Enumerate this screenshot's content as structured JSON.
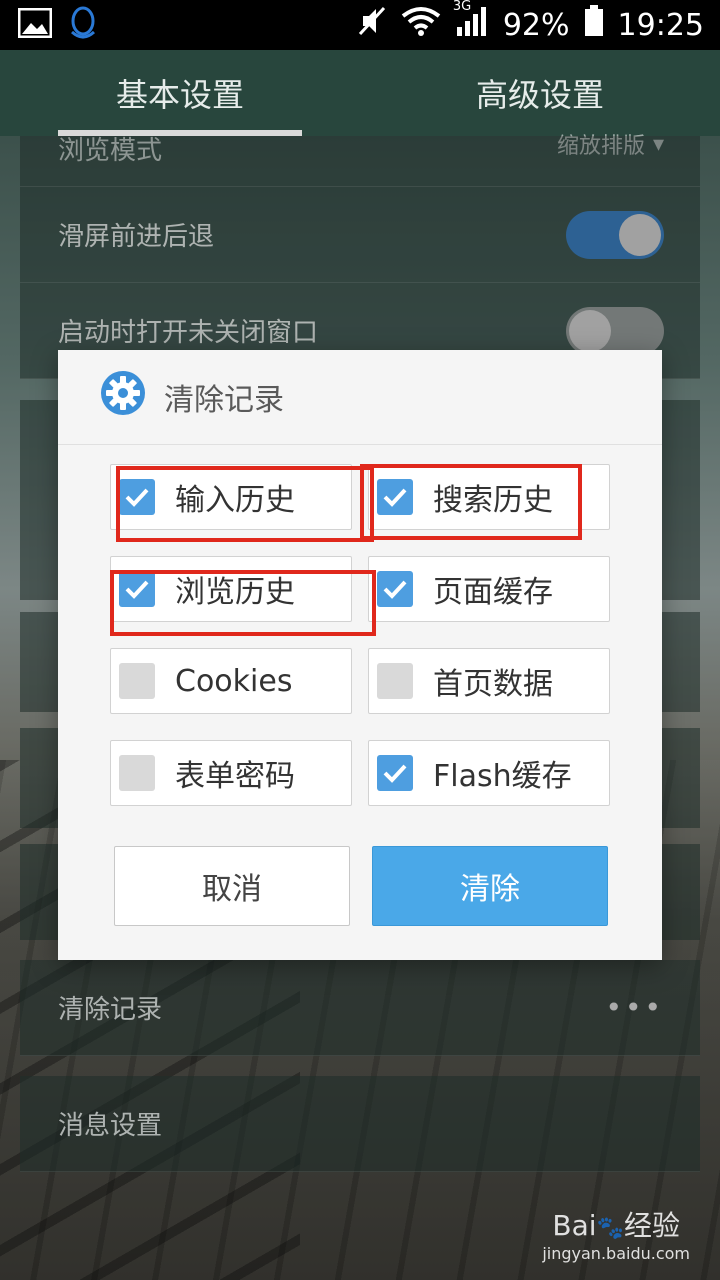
{
  "status_bar": {
    "network": "3G",
    "battery": "92%",
    "time": "19:25",
    "icons": [
      "image-icon",
      "qq-penguin-icon",
      "mute-icon",
      "wifi-icon",
      "signal-icon",
      "battery-icon"
    ]
  },
  "tabs": [
    {
      "label": "基本设置",
      "active": true
    },
    {
      "label": "高级设置",
      "active": false
    }
  ],
  "settings": {
    "browse_mode": {
      "label": "浏览模式",
      "value": "缩放排版"
    },
    "swipe_nav": {
      "label": "滑屏前进后退",
      "enabled": true
    },
    "restore_windows": {
      "label": "启动时打开未关闭窗口",
      "enabled": false
    },
    "clear_records": {
      "label": "清除记录"
    },
    "message_settings": {
      "label": "消息设置"
    }
  },
  "dialog": {
    "title": "清除记录",
    "options": [
      {
        "label": "输入历史",
        "checked": true
      },
      {
        "label": "搜索历史",
        "checked": true
      },
      {
        "label": "浏览历史",
        "checked": true
      },
      {
        "label": "页面缓存",
        "checked": true
      },
      {
        "label": "Cookies",
        "checked": false
      },
      {
        "label": "首页数据",
        "checked": false
      },
      {
        "label": "表单密码",
        "checked": false
      },
      {
        "label": "Flash缓存",
        "checked": true
      }
    ],
    "cancel_label": "取消",
    "confirm_label": "清除"
  },
  "colors": {
    "accent": "#4aa8e8",
    "checkbox": "#4e9ee0",
    "highlight": "#e0281c"
  }
}
